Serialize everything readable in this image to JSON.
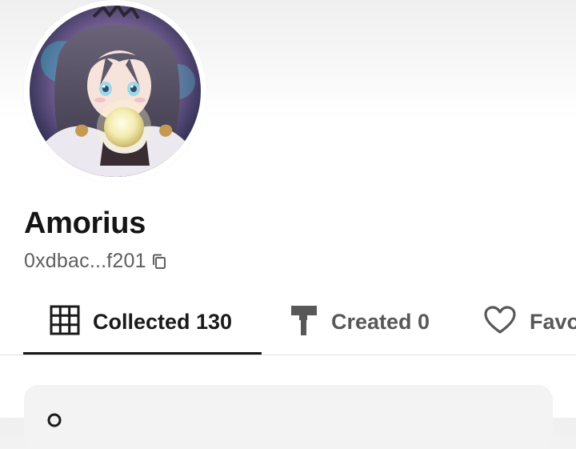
{
  "profile": {
    "name": "Amorius",
    "wallet_address": "0xdbac...f201"
  },
  "tabs": [
    {
      "label": "Collected 130",
      "icon": "grid-icon",
      "active": true
    },
    {
      "label": "Created 0",
      "icon": "paint-roller-icon",
      "active": false
    },
    {
      "label": "Favo",
      "icon": "heart-icon",
      "active": false
    }
  ],
  "colors": {
    "accent": "#161616",
    "muted_text": "#585858",
    "card_background": "#f3f3f4"
  }
}
